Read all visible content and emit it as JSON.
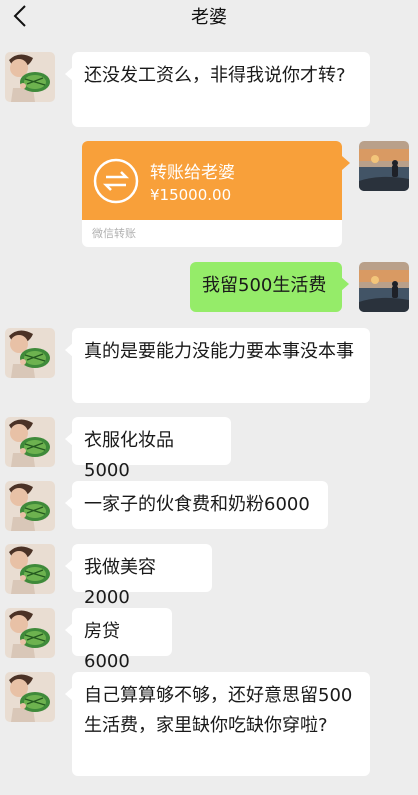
{
  "header": {
    "title": "老婆",
    "back_icon": "chevron-left-icon"
  },
  "messages": [
    {
      "side": "left",
      "text": "还没发工资么，非得我说你才转?"
    },
    {
      "side": "right",
      "type": "transfer",
      "title": "转账给老婆",
      "amount": "¥15000.00",
      "caption": "微信转账"
    },
    {
      "side": "right",
      "text": "我留500生活费"
    },
    {
      "side": "left",
      "text": "真的是要能力没能力要本事没本事"
    },
    {
      "side": "left",
      "text": "衣服化妆品5000"
    },
    {
      "side": "left",
      "text": "一家子的伙食费和奶粉6000"
    },
    {
      "side": "left",
      "text": "我做美容2000"
    },
    {
      "side": "left",
      "text": "房贷6000"
    },
    {
      "side": "left",
      "text": "自己算算够不够，还好意思留500生活费，家里缺你吃缺你穿啦?"
    }
  ],
  "colors": {
    "background": "#ededed",
    "self_bubble": "#95ec69",
    "transfer": "#f8a03a"
  }
}
